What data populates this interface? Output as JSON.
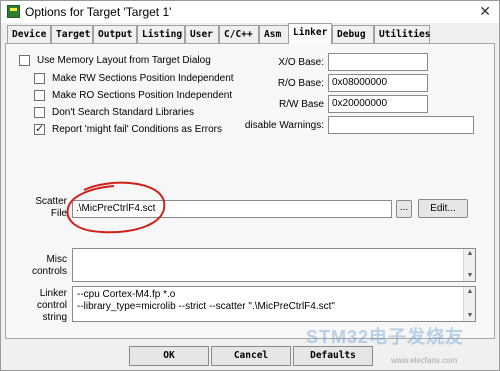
{
  "window": {
    "title": "Options for Target 'Target 1'",
    "close_glyph": "✕"
  },
  "tabs": [
    {
      "label": "Device"
    },
    {
      "label": "Target"
    },
    {
      "label": "Output"
    },
    {
      "label": "Listing"
    },
    {
      "label": "User"
    },
    {
      "label": "C/C++"
    },
    {
      "label": "Asm"
    },
    {
      "label": "Linker"
    },
    {
      "label": "Debug"
    },
    {
      "label": "Utilities"
    }
  ],
  "active_tab": "Linker",
  "checkboxes": [
    {
      "label": "Use Memory Layout from Target Dialog",
      "checked": false
    },
    {
      "label": "Make RW Sections Position Independent",
      "checked": false
    },
    {
      "label": "Make RO Sections Position Independent",
      "checked": false
    },
    {
      "label": "Don't Search Standard Libraries",
      "checked": false
    },
    {
      "label": "Report 'might fail' Conditions as Errors",
      "checked": true
    }
  ],
  "fields": {
    "xo_base": {
      "label": "X/O Base:",
      "value": ""
    },
    "ro_base": {
      "label": "R/O Base:",
      "value": "0x08000000"
    },
    "rw_base": {
      "label": "R/W Base",
      "value": "0x20000000"
    },
    "disable_warnings": {
      "label": "disable Warnings:",
      "value": ""
    }
  },
  "scatter": {
    "label_line1": "Scatter",
    "label_line2": "File",
    "value": ".\\MicPreCtrlF4.sct",
    "browse_label": "...",
    "edit_label": "Edit...",
    "annotation_color": "#d0201c"
  },
  "misc": {
    "label_line1": "Misc",
    "label_line2": "controls",
    "value": ""
  },
  "linker_string": {
    "label_line1": "Linker",
    "label_line2": "control",
    "label_line3": "string",
    "line1": "--cpu Cortex-M4.fp *.o",
    "line2": "--library_type=microlib --strict --scatter \".\\MicPreCtrlF4.sct\""
  },
  "buttons": {
    "ok": "OK",
    "cancel": "Cancel",
    "defaults": "Defaults"
  },
  "watermark": {
    "text": "STM32电子发烧友",
    "sub": "www.elecfans.com"
  }
}
